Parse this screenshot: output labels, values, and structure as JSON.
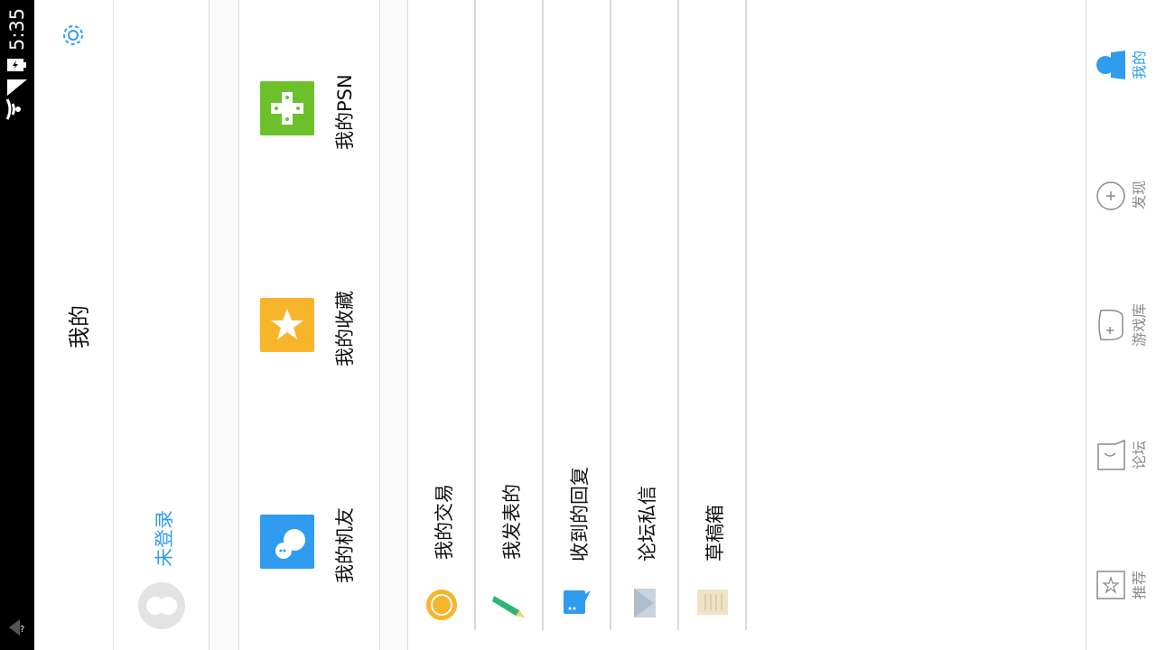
{
  "status_bar": {
    "time": "5:35"
  },
  "header": {
    "title": "我的"
  },
  "profile": {
    "login_label": "未登录"
  },
  "tiles": [
    {
      "label": "我的机友",
      "color": "#2f9cf0",
      "icon": "friends-icon"
    },
    {
      "label": "我的收藏",
      "color": "#f7b52c",
      "icon": "star-icon"
    },
    {
      "label": "我的PSN",
      "color": "#6cc02a",
      "icon": "gamepad-icon"
    }
  ],
  "list": [
    {
      "label": "我的交易",
      "icon": "coin-icon"
    },
    {
      "label": "我发表的",
      "icon": "pencil-icon"
    },
    {
      "label": "收到的回复",
      "icon": "reply-bubble-icon"
    },
    {
      "label": "论坛私信",
      "icon": "mail-icon"
    },
    {
      "label": "草稿箱",
      "icon": "draft-icon"
    }
  ],
  "nav": [
    {
      "label": "我的",
      "active": true,
      "icon": "person-icon"
    },
    {
      "label": "发现",
      "active": false,
      "icon": "compass-icon"
    },
    {
      "label": "游戏库",
      "active": false,
      "icon": "controller-icon"
    },
    {
      "label": "论坛",
      "active": false,
      "icon": "forum-icon"
    },
    {
      "label": "推荐",
      "active": false,
      "icon": "star-outline-icon"
    }
  ],
  "colors": {
    "accent": "#2f9cf0",
    "nav_inactive": "#8a8a8a"
  }
}
